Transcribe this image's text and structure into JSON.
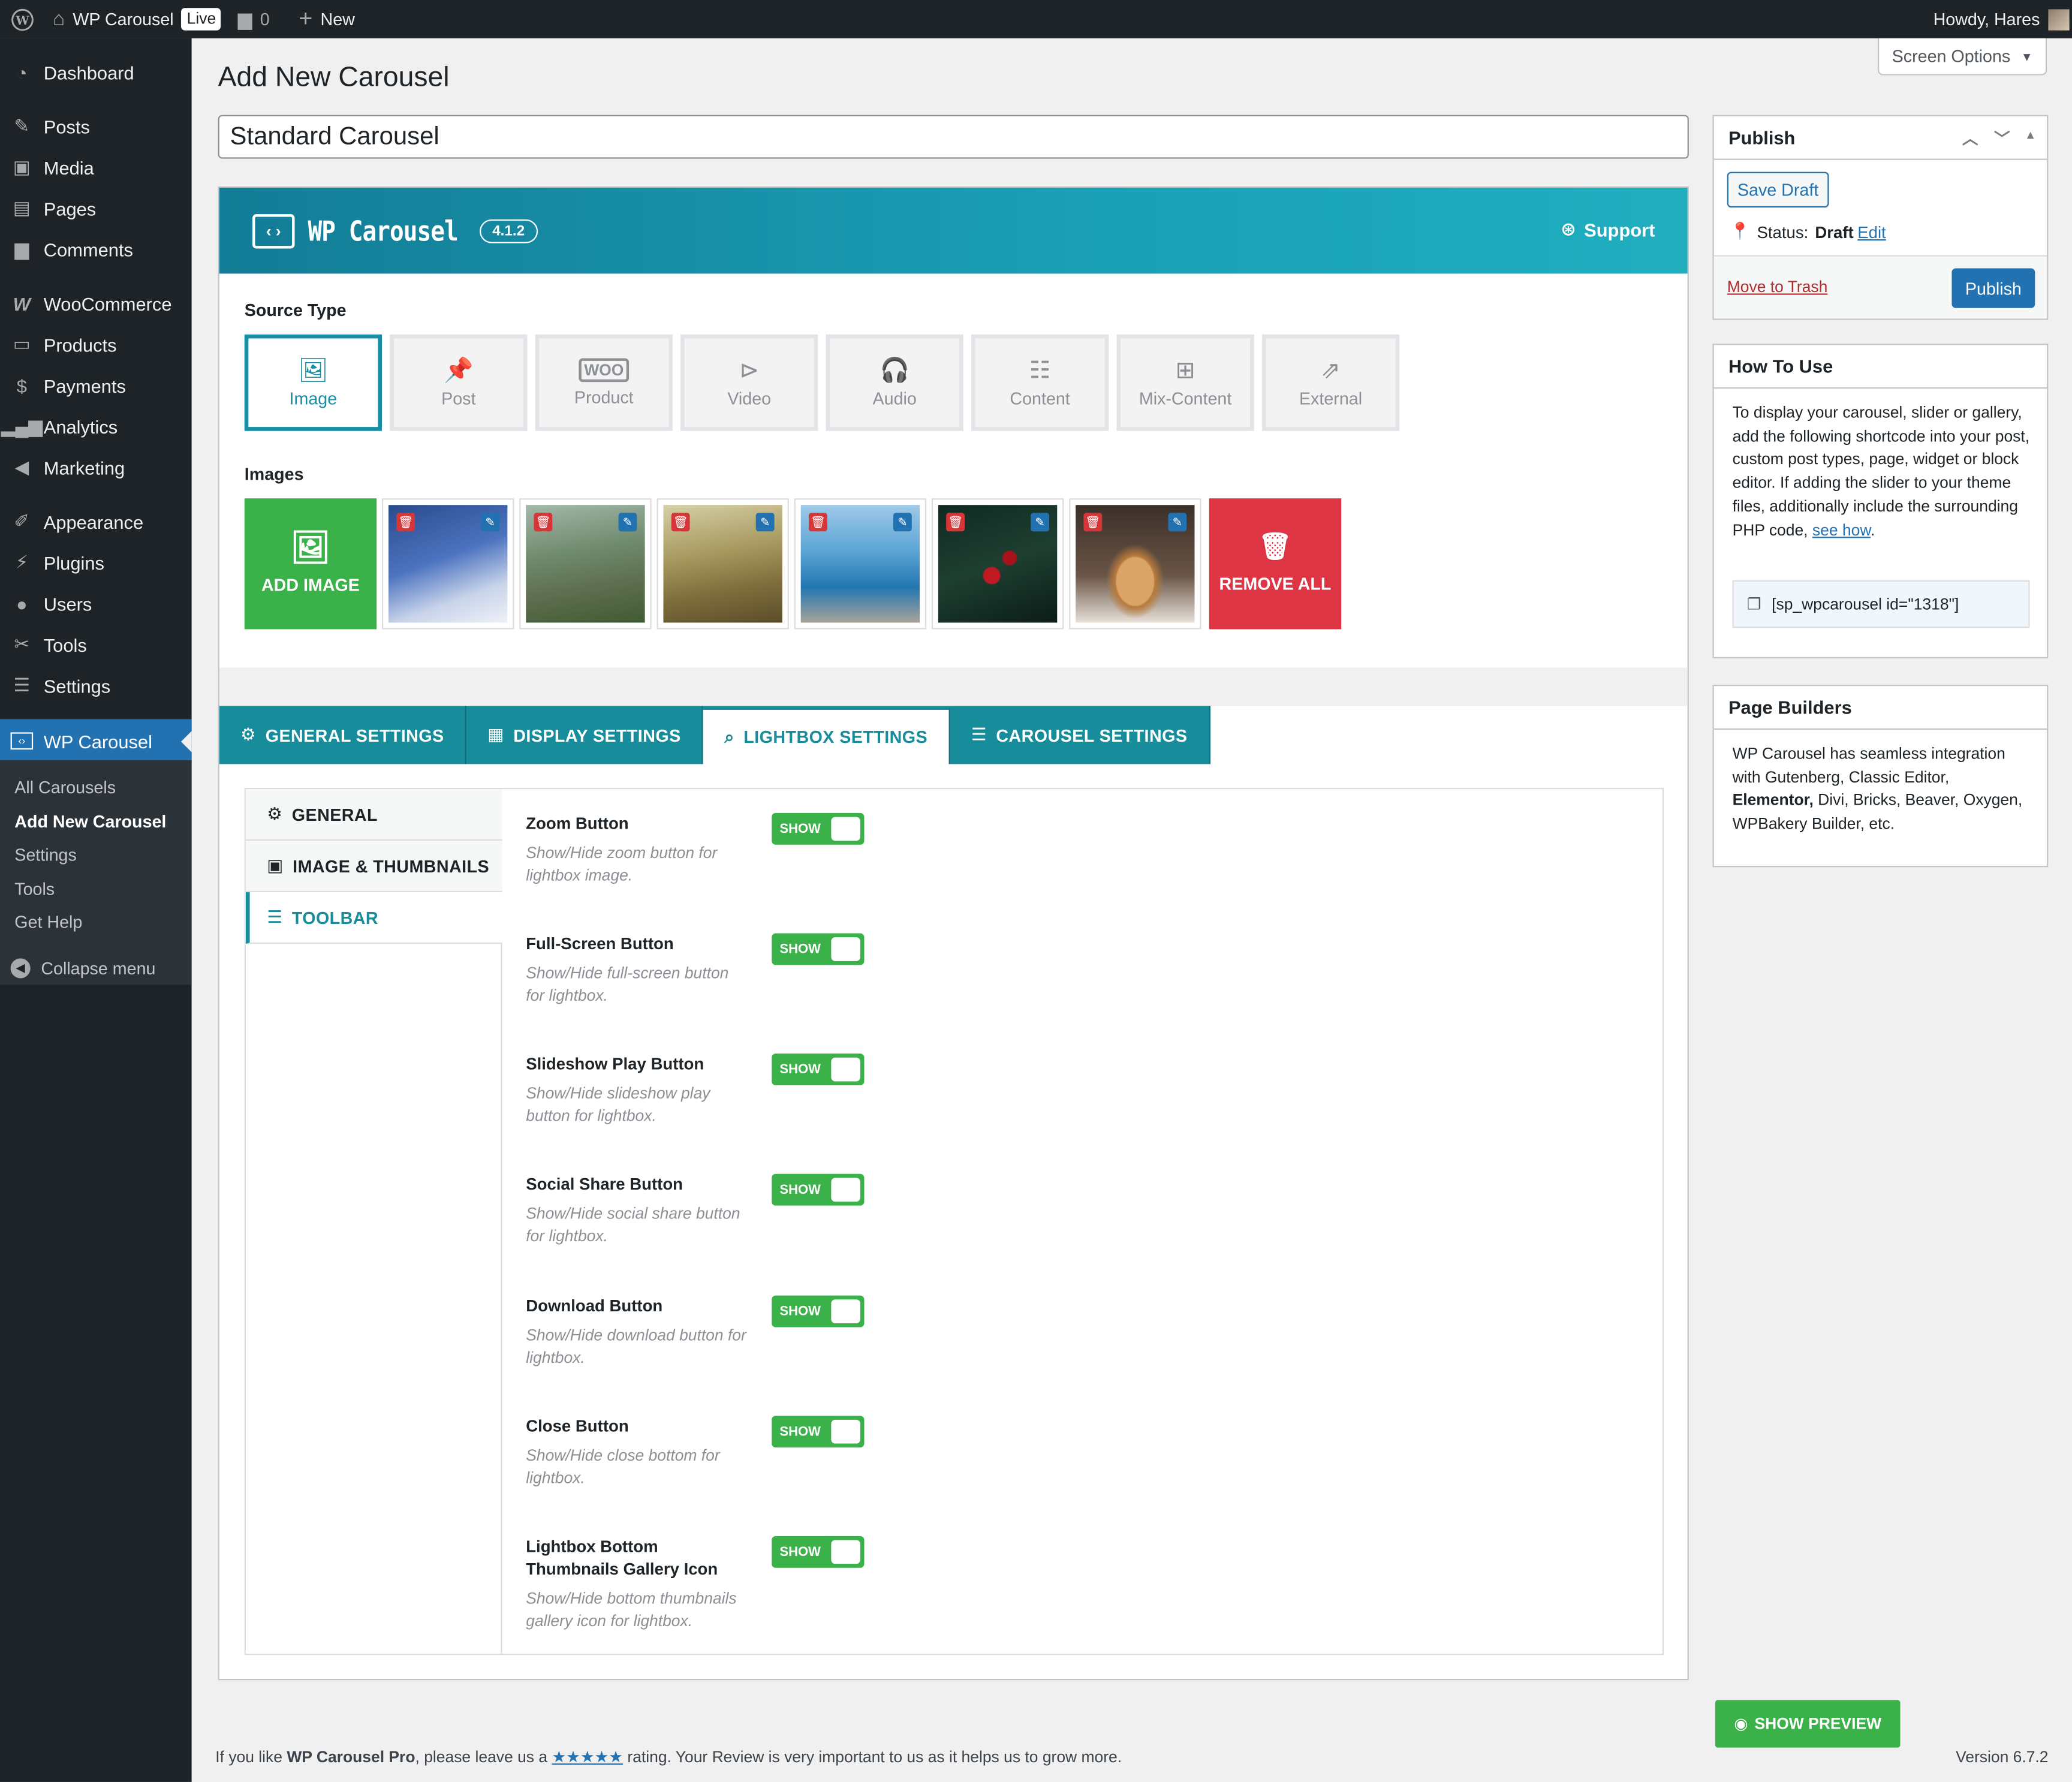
{
  "adminbar": {
    "site_name": "WP Carousel",
    "live_badge": "Live",
    "comments_count": "0",
    "new_label": "New",
    "howdy": "Howdy, Hares"
  },
  "sidebar": {
    "items": [
      {
        "label": "Dashboard",
        "icon": "dashboard-icon"
      },
      {
        "label": "Posts",
        "icon": "pin-icon"
      },
      {
        "label": "Media",
        "icon": "media-icon"
      },
      {
        "label": "Pages",
        "icon": "pages-icon"
      },
      {
        "label": "Comments",
        "icon": "comment-icon"
      },
      {
        "label": "WooCommerce",
        "icon": "woo-icon"
      },
      {
        "label": "Products",
        "icon": "archive-icon"
      },
      {
        "label": "Payments",
        "icon": "dollar-icon"
      },
      {
        "label": "Analytics",
        "icon": "bar-chart-icon"
      },
      {
        "label": "Marketing",
        "icon": "megaphone-icon"
      },
      {
        "label": "Appearance",
        "icon": "brush-icon"
      },
      {
        "label": "Plugins",
        "icon": "plug-icon"
      },
      {
        "label": "Users",
        "icon": "user-icon"
      },
      {
        "label": "Tools",
        "icon": "wrench-icon"
      },
      {
        "label": "Settings",
        "icon": "sliders-icon"
      },
      {
        "label": "WP Carousel",
        "icon": "carousel-icon"
      }
    ],
    "submenu": [
      "All Carousels",
      "Add New Carousel",
      "Settings",
      "Tools",
      "Get Help"
    ],
    "collapse": "Collapse menu"
  },
  "page": {
    "title": "Add New Carousel",
    "post_title": "Standard Carousel",
    "screen_options": "Screen Options"
  },
  "wpc": {
    "brand": "WP Carousel",
    "version": "4.1.2",
    "support": "Support",
    "source_type_label": "Source Type",
    "source_types": [
      "Image",
      "Post",
      "Product",
      "Video",
      "Audio",
      "Content",
      "Mix-Content",
      "External"
    ],
    "images_label": "Images",
    "add_image": "ADD IMAGE",
    "remove_all": "REMOVE ALL",
    "tabs": [
      "GENERAL SETTINGS",
      "DISPLAY SETTINGS",
      "LIGHTBOX SETTINGS",
      "CAROUSEL SETTINGS"
    ],
    "subtabs": [
      "GENERAL",
      "IMAGE & THUMBNAILS",
      "TOOLBAR"
    ],
    "fields": [
      {
        "title": "Zoom Button",
        "desc": "Show/Hide zoom button for lightbox image.",
        "toggle": "SHOW"
      },
      {
        "title": "Full-Screen Button",
        "desc": "Show/Hide full-screen button for lightbox.",
        "toggle": "SHOW"
      },
      {
        "title": "Slideshow Play Button",
        "desc": "Show/Hide slideshow play button for lightbox.",
        "toggle": "SHOW"
      },
      {
        "title": "Social Share Button",
        "desc": "Show/Hide social share button for lightbox.",
        "toggle": "SHOW"
      },
      {
        "title": "Download Button",
        "desc": "Show/Hide download button for lightbox.",
        "toggle": "SHOW"
      },
      {
        "title": "Close Button",
        "desc": "Show/Hide close bottom for lightbox.",
        "toggle": "SHOW"
      },
      {
        "title": "Lightbox Bottom Thumbnails Gallery Icon",
        "desc": "Show/Hide bottom thumbnails gallery icon for lightbox.",
        "toggle": "SHOW"
      }
    ]
  },
  "publish": {
    "title": "Publish",
    "save_draft": "Save Draft",
    "status_label": "Status:",
    "status_value": "Draft",
    "edit": "Edit",
    "trash": "Move to Trash",
    "publish": "Publish"
  },
  "howto": {
    "title": "How To Use",
    "text": "To display your carousel, slider or gallery, add the following shortcode into your post, custom post types, page, widget or block editor. If adding the slider to your theme files, additionally include the surrounding PHP code,",
    "link": "see how",
    "period": ".",
    "shortcode": "[sp_wpcarousel id=\"1318\"]"
  },
  "builders": {
    "title": "Page Builders",
    "text_a": "WP Carousel has seamless integration with Gutenberg, Classic Editor,",
    "bold": "Elementor,",
    "text_b": "Divi, Bricks, Beaver, Oxygen, WPBakery Builder, etc."
  },
  "footer": {
    "prefix": "If you like",
    "product": "WP Carousel Pro",
    "mid": ", please leave us a",
    "stars": "★★★★★",
    "suffix": "rating. Your Review is very important to us as it helps us to grow more.",
    "version": "Version 6.7.2"
  },
  "preview": "SHOW PREVIEW",
  "colors": {
    "teal": "#178c9b",
    "green": "#3bb14a",
    "red": "#de3545",
    "wp_blue": "#2271b1",
    "admin_dark": "#1d2327"
  }
}
